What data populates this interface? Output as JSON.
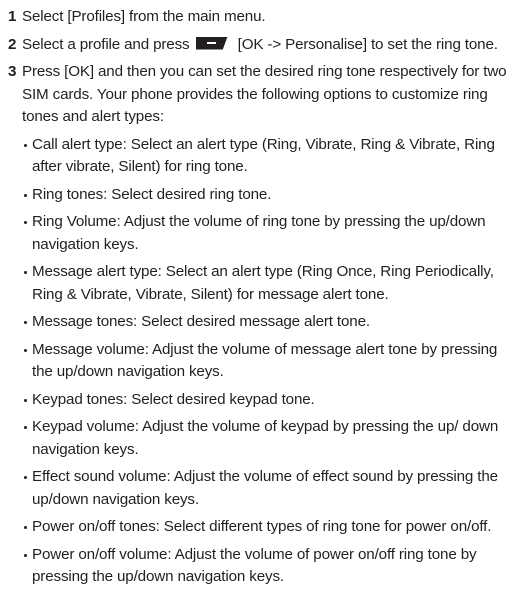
{
  "steps": [
    {
      "num": "1",
      "text": "Select [Profiles] from the main menu."
    },
    {
      "num": "2",
      "before": "Select a profile and press",
      "key_icon": "ok-softkey-icon",
      "after": "[OK -> Personalise] to set the ring tone."
    },
    {
      "num": "3",
      "text": "Press [OK] and then you can set the desired ring tone respectively for two SIM cards. Your phone provides the following options to customize ring tones and alert types:"
    }
  ],
  "bullets": [
    "Call alert type: Select an alert type (Ring, Vibrate, Ring & Vibrate, Ring after vibrate, Silent) for ring tone.",
    "Ring tones: Select desired ring tone.",
    "Ring Volume: Adjust the volume of ring tone by pressing the up/down navigation keys.",
    "Message alert type: Select an alert type (Ring Once, Ring Periodically, Ring & Vibrate, Vibrate, Silent) for message alert tone.",
    "Message tones: Select desired message alert tone.",
    "Message volume: Adjust the volume of message alert tone by pressing the up/down navigation keys.",
    "Keypad tones: Select desired keypad tone.",
    "Keypad volume: Adjust the volume of keypad by pressing the up/ down navigation keys.",
    "Effect sound volume: Adjust the volume of effect sound by pressing the up/down navigation keys.",
    "Power on/off tones: Select different types of ring tone for power on/off.",
    "Power on/off volume: Adjust the volume of power on/off ring tone by pressing the up/down navigation keys."
  ]
}
